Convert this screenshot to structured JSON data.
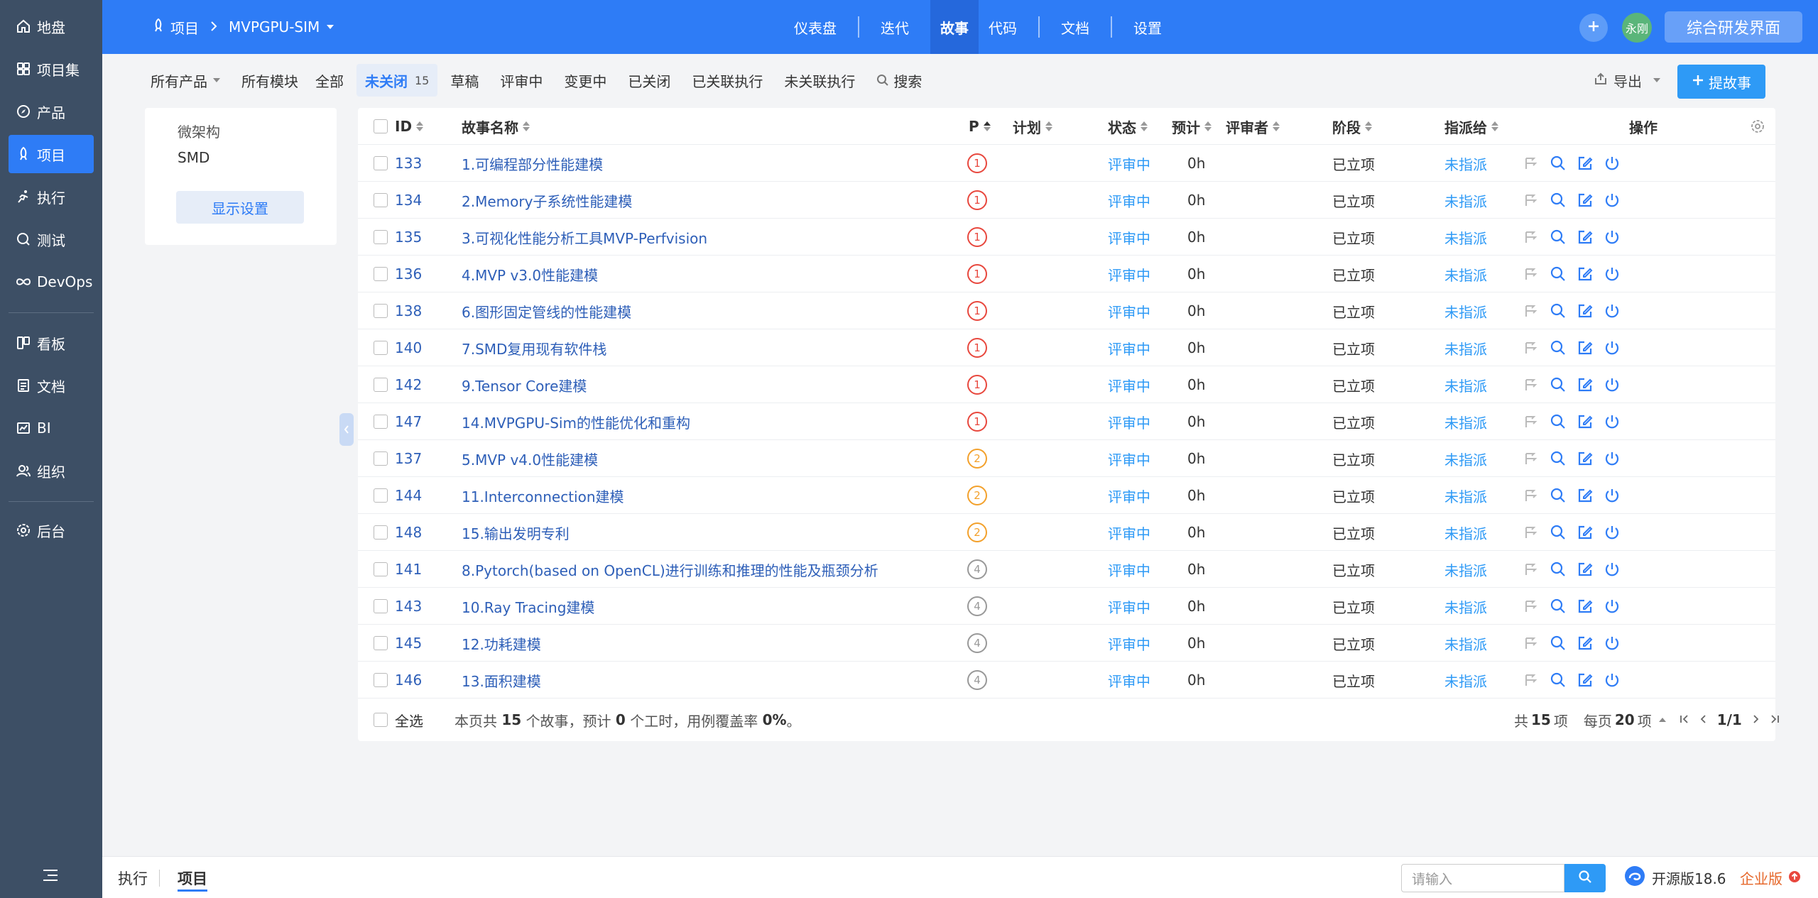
{
  "sidebar": {
    "items": [
      {
        "label": "地盘",
        "icon": "home-icon"
      },
      {
        "label": "项目集",
        "icon": "grid-icon"
      },
      {
        "label": "产品",
        "icon": "compass-icon"
      },
      {
        "label": "项目",
        "icon": "rocket-icon",
        "active": true
      },
      {
        "label": "执行",
        "icon": "run-icon"
      },
      {
        "label": "测试",
        "icon": "bug-search-icon"
      },
      {
        "label": "DevOps",
        "icon": "infinity-icon"
      },
      {
        "label": "看板",
        "icon": "kanban-icon"
      },
      {
        "label": "文档",
        "icon": "doc-icon"
      },
      {
        "label": "BI",
        "icon": "chart-icon"
      },
      {
        "label": "组织",
        "icon": "people-icon"
      },
      {
        "label": "后台",
        "icon": "gear-icon"
      }
    ]
  },
  "header": {
    "breadcrumb": {
      "root": "项目",
      "current": "MVPGPU-SIM"
    },
    "nav": [
      "仪表盘",
      "迭代",
      "故事",
      "代码",
      "文档",
      "设置"
    ],
    "active_nav": "故事",
    "avatar_text": "永刚",
    "switch_button": "综合研发界面"
  },
  "filters": {
    "product": "所有产品",
    "module": "所有模块",
    "tabs": [
      "全部",
      "未关闭",
      "草稿",
      "评审中",
      "变更中",
      "已关闭",
      "已关联执行",
      "未关联执行"
    ],
    "active_tab": "未关闭",
    "active_count": "15",
    "search": "搜索",
    "export": "导出",
    "add_story": "提故事"
  },
  "module_panel": {
    "items": [
      "微架构",
      "SMD"
    ],
    "display_settings": "显示设置"
  },
  "table": {
    "columns": {
      "id": "ID",
      "name": "故事名称",
      "pri": "P",
      "plan": "计划",
      "status": "状态",
      "estimate": "预计",
      "reviewer": "评审者",
      "stage": "阶段",
      "assigned": "指派给",
      "actions": "操作"
    },
    "rows": [
      {
        "id": "133",
        "name": "1.可编程部分性能建模",
        "pri": "1",
        "status": "评审中",
        "estimate": "0h",
        "stage": "已立项",
        "assigned": "未指派"
      },
      {
        "id": "134",
        "name": "2.Memory子系统性能建模",
        "pri": "1",
        "status": "评审中",
        "estimate": "0h",
        "stage": "已立项",
        "assigned": "未指派"
      },
      {
        "id": "135",
        "name": "3.可视化性能分析工具MVP-Perfvision",
        "pri": "1",
        "status": "评审中",
        "estimate": "0h",
        "stage": "已立项",
        "assigned": "未指派"
      },
      {
        "id": "136",
        "name": "4.MVP v3.0性能建模",
        "pri": "1",
        "status": "评审中",
        "estimate": "0h",
        "stage": "已立项",
        "assigned": "未指派"
      },
      {
        "id": "138",
        "name": "6.图形固定管线的性能建模",
        "pri": "1",
        "status": "评审中",
        "estimate": "0h",
        "stage": "已立项",
        "assigned": "未指派"
      },
      {
        "id": "140",
        "name": "7.SMD复用现有软件栈",
        "pri": "1",
        "status": "评审中",
        "estimate": "0h",
        "stage": "已立项",
        "assigned": "未指派"
      },
      {
        "id": "142",
        "name": "9.Tensor Core建模",
        "pri": "1",
        "status": "评审中",
        "estimate": "0h",
        "stage": "已立项",
        "assigned": "未指派"
      },
      {
        "id": "147",
        "name": "14.MVPGPU-Sim的性能优化和重构",
        "pri": "1",
        "status": "评审中",
        "estimate": "0h",
        "stage": "已立项",
        "assigned": "未指派"
      },
      {
        "id": "137",
        "name": "5.MVP v4.0性能建模",
        "pri": "2",
        "status": "评审中",
        "estimate": "0h",
        "stage": "已立项",
        "assigned": "未指派"
      },
      {
        "id": "144",
        "name": "11.Interconnection建模",
        "pri": "2",
        "status": "评审中",
        "estimate": "0h",
        "stage": "已立项",
        "assigned": "未指派"
      },
      {
        "id": "148",
        "name": "15.输出发明专利",
        "pri": "2",
        "status": "评审中",
        "estimate": "0h",
        "stage": "已立项",
        "assigned": "未指派"
      },
      {
        "id": "141",
        "name": "8.Pytorch(based on OpenCL)进行训练和推理的性能及瓶颈分析",
        "pri": "4",
        "status": "评审中",
        "estimate": "0h",
        "stage": "已立项",
        "assigned": "未指派"
      },
      {
        "id": "143",
        "name": "10.Ray Tracing建模",
        "pri": "4",
        "status": "评审中",
        "estimate": "0h",
        "stage": "已立项",
        "assigned": "未指派"
      },
      {
        "id": "145",
        "name": "12.功耗建模",
        "pri": "4",
        "status": "评审中",
        "estimate": "0h",
        "stage": "已立项",
        "assigned": "未指派"
      },
      {
        "id": "146",
        "name": "13.面积建模",
        "pri": "4",
        "status": "评审中",
        "estimate": "0h",
        "stage": "已立项",
        "assigned": "未指派"
      }
    ],
    "footer": {
      "select_all": "全选",
      "summary_pre": "本页共",
      "story_count": "15",
      "summary_mid": "个故事，预计",
      "hours": "0",
      "summary_mid2": "个工时，用例覆盖率",
      "coverage": "0%",
      "summary_end": "。",
      "total_pre": "共",
      "total": "15",
      "total_post": "项",
      "per_page_pre": "每页",
      "per_page": "20",
      "per_page_post": "项",
      "page": "1/1"
    }
  },
  "bottombar": {
    "tabs": [
      "执行",
      "项目"
    ],
    "active_tab": "项目",
    "search_placeholder": "请输入",
    "version": "开源版18.6",
    "enterprise": "企业版"
  }
}
